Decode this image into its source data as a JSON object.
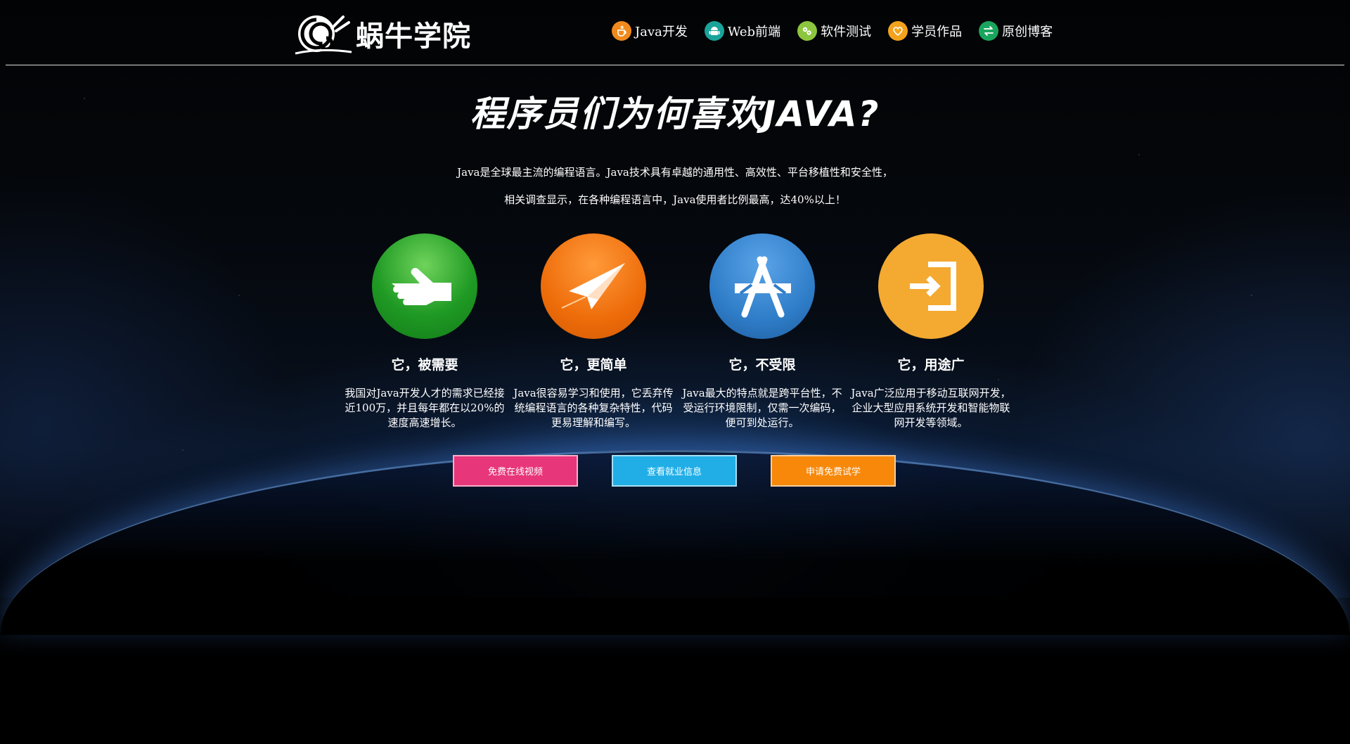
{
  "header": {
    "logo_text": "蜗牛学院",
    "nav": [
      {
        "label": "Java开发",
        "icon": "java-cup-icon",
        "color": "#f08a1c"
      },
      {
        "label": "Web前端",
        "icon": "android-icon",
        "color": "#1aa39a"
      },
      {
        "label": "软件测试",
        "icon": "bug-icon",
        "color": "#8cc63e"
      },
      {
        "label": "学员作品",
        "icon": "heart-badge-icon",
        "color": "#f4a21c"
      },
      {
        "label": "原创博客",
        "icon": "swap-arrows-icon",
        "color": "#1aa55e"
      }
    ]
  },
  "hero": {
    "title": "程序员们为何喜欢JAVA?",
    "intro_line1": "Java是全球最主流的编程语言。Java技术具有卓越的通用性、高效性、平台移植性和安全性，",
    "intro_line2": "相关调查显示，在各种编程语言中，Java使用者比例最高，达40%以上！"
  },
  "features": [
    {
      "title": "它，被需要",
      "desc": "我国对Java开发人才的需求已经接近100万，并且每年都在以20%的速度高速增长。",
      "icon": "open-hand-icon",
      "color": "#1f9a24"
    },
    {
      "title": "它，更简单",
      "desc": "Java很容易学习和使用，它丢弃传统编程语言的各种复杂特性，代码更易理解和编写。",
      "icon": "paper-plane-icon",
      "color": "#ee6c0a"
    },
    {
      "title": "它，不受限",
      "desc": "Java最大的特点就是跨平台性，不受运行环境限制，仅需一次编码，便可到处运行。",
      "icon": "app-store-icon",
      "color": "#2f7dc8"
    },
    {
      "title": "它，用途广",
      "desc": "Java广泛应用于移动互联网开发，企业大型应用系统开发和智能物联网开发等领域。",
      "icon": "sign-in-icon",
      "color": "#f4a930"
    }
  ],
  "buttons": [
    {
      "label": "免费在线视频",
      "color": "#e8367a"
    },
    {
      "label": "查看就业信息",
      "color": "#21aee6"
    },
    {
      "label": "申请免费试学",
      "color": "#f7880a"
    }
  ]
}
